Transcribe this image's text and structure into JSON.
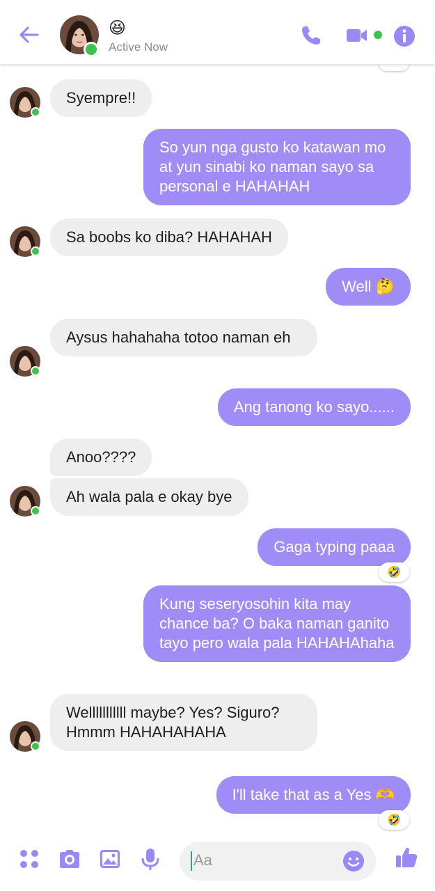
{
  "header": {
    "contact_name": "😆",
    "status": "Active Now",
    "accent_color": "#a08cf7",
    "online_color": "#3fc24d"
  },
  "messages": [
    {
      "side": "in",
      "text": "Syempre!!"
    },
    {
      "side": "out",
      "text": "So yun nga gusto ko katawan mo at yun sinabi ko naman sayo sa personal e HAHAHAH"
    },
    {
      "side": "in",
      "text": "Sa boobs ko diba? HAHAHAH"
    },
    {
      "side": "out",
      "text": "Well 🤔"
    },
    {
      "side": "in",
      "text": "Aysus hahahaha totoo naman eh"
    },
    {
      "side": "out",
      "text": "Ang tanong ko sayo......"
    },
    {
      "side": "in",
      "text": "Anoo????"
    },
    {
      "side": "in",
      "text": "Ah wala pala e okay bye"
    },
    {
      "side": "out",
      "text": "Gaga typing paaa",
      "reaction": "🤣"
    },
    {
      "side": "out",
      "text": "Kung seseryosohin kita may chance ba? O baka naman ganito tayo pero wala pala HAHAHAhaha"
    },
    {
      "side": "in",
      "text": "Welllllllllll maybe? Yes? Siguro? Hmmm HAHAHAHAHA"
    },
    {
      "side": "out",
      "text": "I'll take that as a Yes 🫶",
      "reaction": "🤣"
    }
  ],
  "composer": {
    "placeholder": "Aa",
    "icons": [
      "apps-icon",
      "camera-icon",
      "gallery-icon",
      "microphone-icon",
      "emoji-icon",
      "thumbs-up-icon"
    ]
  }
}
